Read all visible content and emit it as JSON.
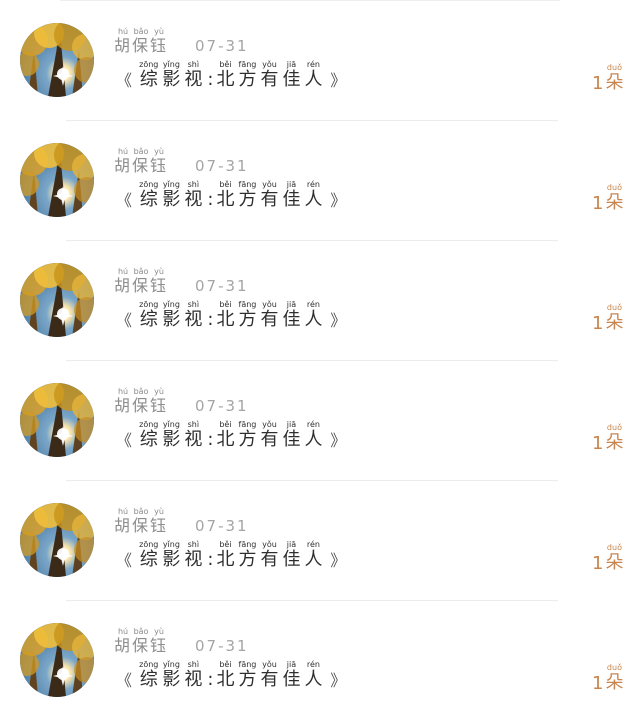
{
  "app": {
    "title": ""
  },
  "colors": {
    "background": "#ffffff",
    "author": "#8d8d8d",
    "date": "#a5a5a5",
    "title": "#2f2f2f",
    "count": "#c9854d",
    "divider": "#ececec"
  },
  "icons": {
    "avatar": "forest-canopy-icon"
  },
  "feed": {
    "items": [
      {
        "author": [
          {
            "text": "胡",
            "pinyin": "hú"
          },
          {
            "text": "保",
            "pinyin": "bǎo"
          },
          {
            "text": "钰",
            "pinyin": "yù"
          }
        ],
        "date": "07-31",
        "title_open": "《",
        "title_chars": [
          {
            "text": "综",
            "pinyin": "zōng"
          },
          {
            "text": "影",
            "pinyin": "yǐng"
          },
          {
            "text": "视",
            "pinyin": "shì"
          }
        ],
        "title_colon": ":",
        "title_chars_2": [
          {
            "text": "北",
            "pinyin": "běi"
          },
          {
            "text": "方",
            "pinyin": "fāng"
          },
          {
            "text": "有",
            "pinyin": "yǒu"
          },
          {
            "text": "佳",
            "pinyin": "jiā"
          },
          {
            "text": "人",
            "pinyin": "rén"
          }
        ],
        "title_close": "》",
        "count_number": "1",
        "count_unit": {
          "text": "朵",
          "pinyin": "duǒ"
        }
      },
      {
        "author": [
          {
            "text": "胡",
            "pinyin": "hú"
          },
          {
            "text": "保",
            "pinyin": "bǎo"
          },
          {
            "text": "钰",
            "pinyin": "yù"
          }
        ],
        "date": "07-31",
        "title_open": "《",
        "title_chars": [
          {
            "text": "综",
            "pinyin": "zōng"
          },
          {
            "text": "影",
            "pinyin": "yǐng"
          },
          {
            "text": "视",
            "pinyin": "shì"
          }
        ],
        "title_colon": ":",
        "title_chars_2": [
          {
            "text": "北",
            "pinyin": "běi"
          },
          {
            "text": "方",
            "pinyin": "fāng"
          },
          {
            "text": "有",
            "pinyin": "yǒu"
          },
          {
            "text": "佳",
            "pinyin": "jiā"
          },
          {
            "text": "人",
            "pinyin": "rén"
          }
        ],
        "title_close": "》",
        "count_number": "1",
        "count_unit": {
          "text": "朵",
          "pinyin": "duǒ"
        }
      },
      {
        "author": [
          {
            "text": "胡",
            "pinyin": "hú"
          },
          {
            "text": "保",
            "pinyin": "bǎo"
          },
          {
            "text": "钰",
            "pinyin": "yù"
          }
        ],
        "date": "07-31",
        "title_open": "《",
        "title_chars": [
          {
            "text": "综",
            "pinyin": "zōng"
          },
          {
            "text": "影",
            "pinyin": "yǐng"
          },
          {
            "text": "视",
            "pinyin": "shì"
          }
        ],
        "title_colon": ":",
        "title_chars_2": [
          {
            "text": "北",
            "pinyin": "běi"
          },
          {
            "text": "方",
            "pinyin": "fāng"
          },
          {
            "text": "有",
            "pinyin": "yǒu"
          },
          {
            "text": "佳",
            "pinyin": "jiā"
          },
          {
            "text": "人",
            "pinyin": "rén"
          }
        ],
        "title_close": "》",
        "count_number": "1",
        "count_unit": {
          "text": "朵",
          "pinyin": "duǒ"
        }
      },
      {
        "author": [
          {
            "text": "胡",
            "pinyin": "hú"
          },
          {
            "text": "保",
            "pinyin": "bǎo"
          },
          {
            "text": "钰",
            "pinyin": "yù"
          }
        ],
        "date": "07-31",
        "title_open": "《",
        "title_chars": [
          {
            "text": "综",
            "pinyin": "zōng"
          },
          {
            "text": "影",
            "pinyin": "yǐng"
          },
          {
            "text": "视",
            "pinyin": "shì"
          }
        ],
        "title_colon": ":",
        "title_chars_2": [
          {
            "text": "北",
            "pinyin": "běi"
          },
          {
            "text": "方",
            "pinyin": "fāng"
          },
          {
            "text": "有",
            "pinyin": "yǒu"
          },
          {
            "text": "佳",
            "pinyin": "jiā"
          },
          {
            "text": "人",
            "pinyin": "rén"
          }
        ],
        "title_close": "》",
        "count_number": "1",
        "count_unit": {
          "text": "朵",
          "pinyin": "duǒ"
        }
      },
      {
        "author": [
          {
            "text": "胡",
            "pinyin": "hú"
          },
          {
            "text": "保",
            "pinyin": "bǎo"
          },
          {
            "text": "钰",
            "pinyin": "yù"
          }
        ],
        "date": "07-31",
        "title_open": "《",
        "title_chars": [
          {
            "text": "综",
            "pinyin": "zōng"
          },
          {
            "text": "影",
            "pinyin": "yǐng"
          },
          {
            "text": "视",
            "pinyin": "shì"
          }
        ],
        "title_colon": ":",
        "title_chars_2": [
          {
            "text": "北",
            "pinyin": "běi"
          },
          {
            "text": "方",
            "pinyin": "fāng"
          },
          {
            "text": "有",
            "pinyin": "yǒu"
          },
          {
            "text": "佳",
            "pinyin": "jiā"
          },
          {
            "text": "人",
            "pinyin": "rén"
          }
        ],
        "title_close": "》",
        "count_number": "1",
        "count_unit": {
          "text": "朵",
          "pinyin": "duǒ"
        }
      },
      {
        "author": [
          {
            "text": "胡",
            "pinyin": "hú"
          },
          {
            "text": "保",
            "pinyin": "bǎo"
          },
          {
            "text": "钰",
            "pinyin": "yù"
          }
        ],
        "date": "07-31",
        "title_open": "《",
        "title_chars": [
          {
            "text": "综",
            "pinyin": "zōng"
          },
          {
            "text": "影",
            "pinyin": "yǐng"
          },
          {
            "text": "视",
            "pinyin": "shì"
          }
        ],
        "title_colon": ":",
        "title_chars_2": [
          {
            "text": "北",
            "pinyin": "běi"
          },
          {
            "text": "方",
            "pinyin": "fāng"
          },
          {
            "text": "有",
            "pinyin": "yǒu"
          },
          {
            "text": "佳",
            "pinyin": "jiā"
          },
          {
            "text": "人",
            "pinyin": "rén"
          }
        ],
        "title_close": "》",
        "count_number": "1",
        "count_unit": {
          "text": "朵",
          "pinyin": "duǒ"
        }
      }
    ]
  }
}
